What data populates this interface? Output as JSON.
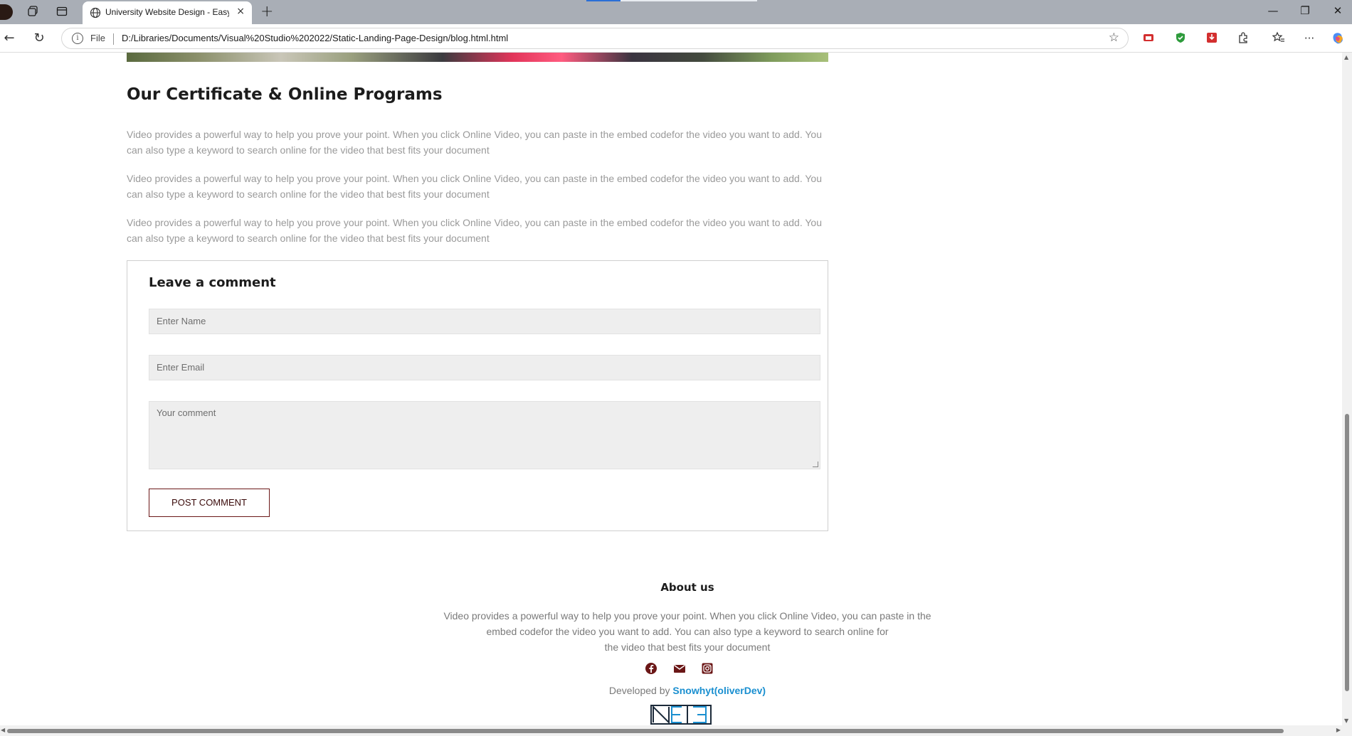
{
  "browser": {
    "tab_title": "University Website Design - Easy",
    "tab_close": "×",
    "new_tab": "+",
    "file_label": "File",
    "url": "D:/Libraries/Documents/Visual%20Studio%202022/Static-Landing-Page-Design/blog.html.html",
    "win_minimize": "—",
    "win_restore": "❐",
    "win_close": "✕",
    "back": "←",
    "reload": "↻",
    "star": "☆",
    "more": "···"
  },
  "article": {
    "title": "Our Certificate & Online Programs",
    "paragraphs": [
      "Video provides a powerful way to help you prove your point. When you click Online Video, you can paste in the embed codefor the video you want to add. You can also type a keyword to search online for the video that best fits your document",
      "Video provides a powerful way to help you prove your point. When you click Online Video, you can paste in the embed codefor the video you want to add. You can also type a keyword to search online for the video that best fits your document",
      "Video provides a powerful way to help you prove your point. When you click Online Video, you can paste in the embed codefor the video you want to add. You can also type a keyword to search online for the video that best fits your document"
    ]
  },
  "comment_form": {
    "title": "Leave a comment",
    "name_placeholder": "Enter Name",
    "email_placeholder": "Enter Email",
    "comment_placeholder": "Your comment",
    "submit_label": "POST COMMENT"
  },
  "footer": {
    "about_title": "About us",
    "about_lines": [
      "Video provides a powerful way to help you prove your point. When you click Online Video, you can paste in the",
      "embed codefor the video you want to add. You can also type a keyword to search online for",
      "the video that best fits your document"
    ],
    "social_icons": [
      "facebook-icon",
      "mail-icon",
      "instagram-icon"
    ],
    "developed_by": "Developed by",
    "developer_name": "Snowhyt(oliverDev)",
    "accent_color": "#6b1717",
    "link_color": "#1a8fd0"
  }
}
